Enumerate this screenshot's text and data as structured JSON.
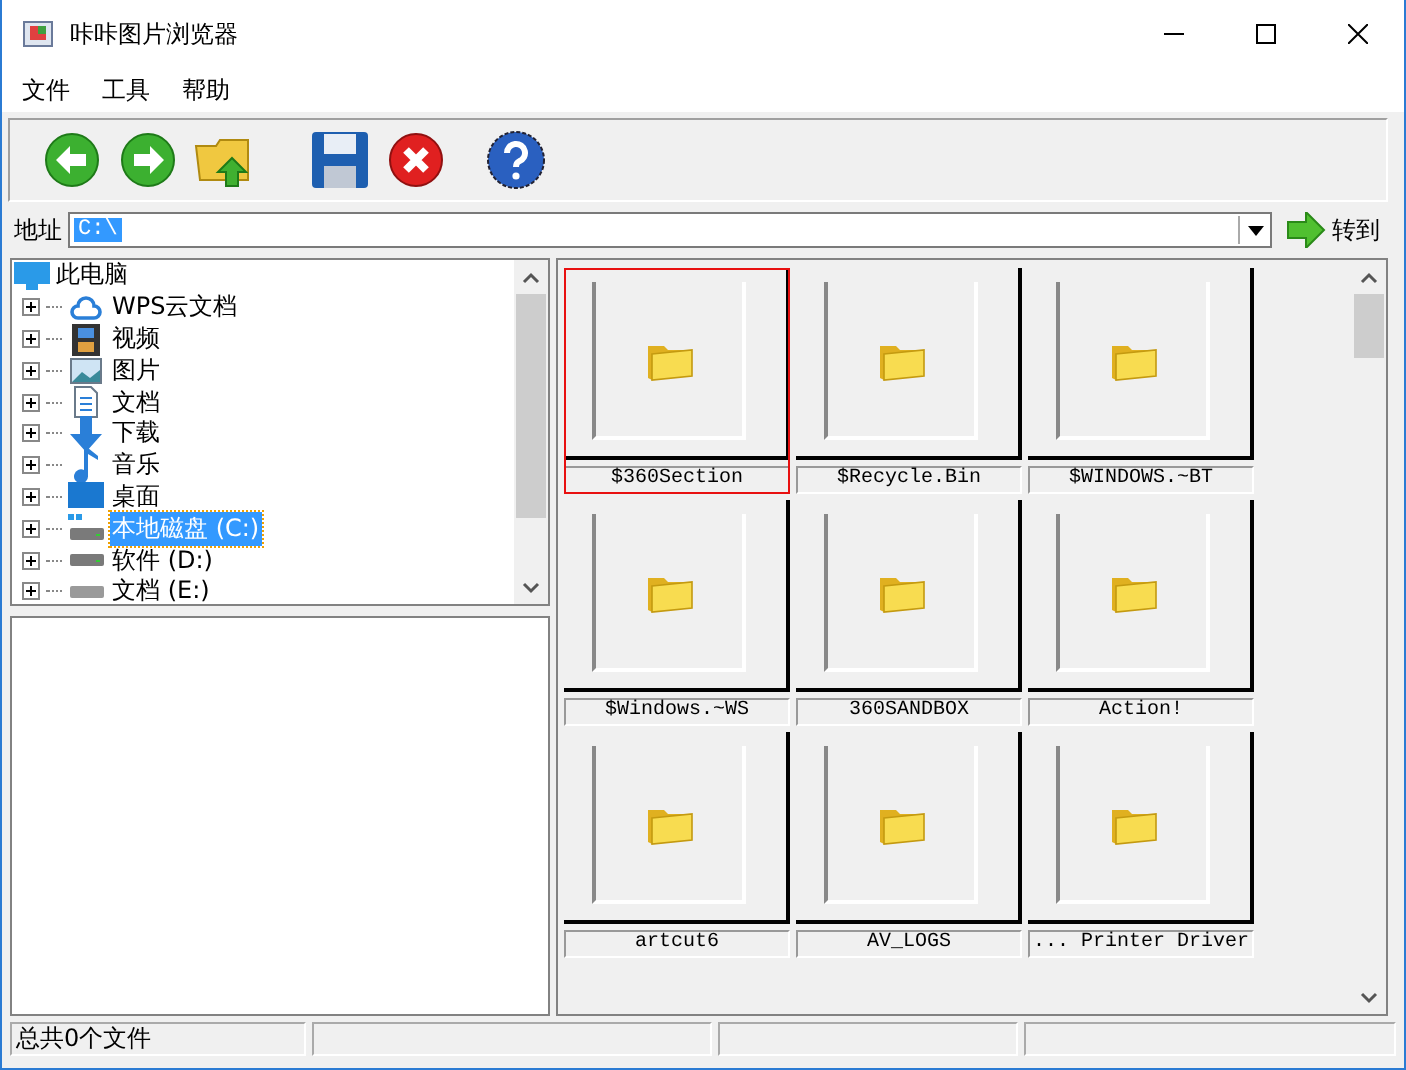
{
  "window": {
    "title": "咔咔图片浏览器"
  },
  "menu": [
    "文件",
    "工具",
    "帮助"
  ],
  "address": {
    "label": "地址",
    "value": "C:\\",
    "go_button": "转到"
  },
  "tree": {
    "label": "此电脑",
    "children": [
      {
        "label": "WPS云文档",
        "expanded": false,
        "selected": false
      },
      {
        "label": "视频",
        "expanded": false,
        "selected": false
      },
      {
        "label": "图片",
        "expanded": false,
        "selected": false
      },
      {
        "label": "文档",
        "expanded": false,
        "selected": false
      },
      {
        "label": "下载",
        "expanded": false,
        "selected": false
      },
      {
        "label": "音乐",
        "expanded": false,
        "selected": false
      },
      {
        "label": "桌面",
        "expanded": false,
        "selected": false
      },
      {
        "label": "本地磁盘 (C:)",
        "expanded": false,
        "selected": true
      },
      {
        "label": "软件 (D:)",
        "expanded": false,
        "selected": false
      },
      {
        "label": "文档 (E:)",
        "expanded": false,
        "selected": false
      }
    ]
  },
  "thumbnails": [
    {
      "name": "$360Section",
      "selected": true
    },
    {
      "name": "$Recycle.Bin",
      "selected": false
    },
    {
      "name": "$WINDOWS.~BT",
      "selected": false
    },
    {
      "name": "$Windows.~WS",
      "selected": false
    },
    {
      "name": "360SANDBOX",
      "selected": false
    },
    {
      "name": "Action!",
      "selected": false
    },
    {
      "name": "artcut6",
      "selected": false
    },
    {
      "name": "AV_LOGS",
      "selected": false
    },
    {
      "name": "... Printer Driver",
      "selected": false
    }
  ],
  "status_bar": [
    "总共0个文件"
  ]
}
